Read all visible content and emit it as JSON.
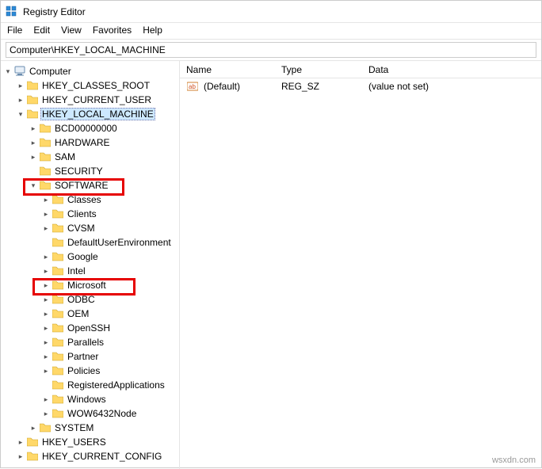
{
  "window": {
    "title": "Registry Editor"
  },
  "menu": {
    "file": "File",
    "edit": "Edit",
    "view": "View",
    "favorites": "Favorites",
    "help": "Help"
  },
  "address": {
    "value": "Computer\\HKEY_LOCAL_MACHINE"
  },
  "tree": {
    "computer": "Computer",
    "hkcr": "HKEY_CLASSES_ROOT",
    "hkcu": "HKEY_CURRENT_USER",
    "hklm": "HKEY_LOCAL_MACHINE",
    "bcd": "BCD00000000",
    "hardware": "HARDWARE",
    "sam": "SAM",
    "security": "SECURITY",
    "software": "SOFTWARE",
    "classes": "Classes",
    "clients": "Clients",
    "cvsm": "CVSM",
    "due": "DefaultUserEnvironment",
    "google": "Google",
    "intel": "Intel",
    "microsoft": "Microsoft",
    "odbc": "ODBC",
    "oem": "OEM",
    "openssh": "OpenSSH",
    "parallels": "Parallels",
    "partner": "Partner",
    "policies": "Policies",
    "regapps": "RegisteredApplications",
    "windows": "Windows",
    "wow64": "WOW6432Node",
    "system": "SYSTEM",
    "hku": "HKEY_USERS",
    "hkcc": "HKEY_CURRENT_CONFIG"
  },
  "values": {
    "headers": {
      "name": "Name",
      "type": "Type",
      "data": "Data"
    },
    "rows": [
      {
        "name": "(Default)",
        "type": "REG_SZ",
        "data": "(value not set)"
      }
    ]
  },
  "watermark": "wsxdn.com"
}
